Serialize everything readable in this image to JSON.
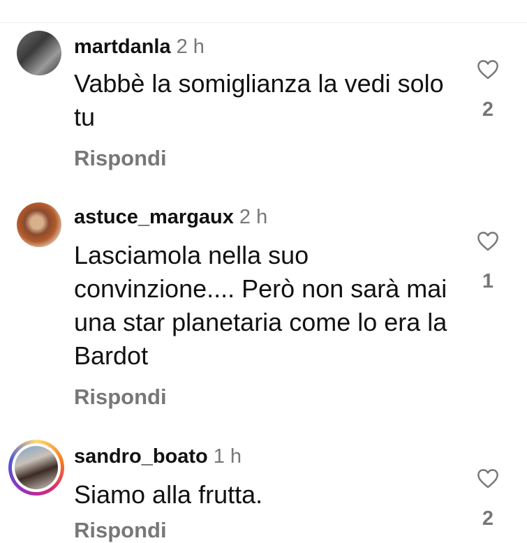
{
  "comments": [
    {
      "username": "martdanla",
      "time": "2 h",
      "text": "Vabbè la somiglianza la vedi solo tu",
      "reply_label": "Rispondi",
      "like_count": "2",
      "icons": {
        "avatar": "avatar-photo",
        "like": "heart-outline-icon"
      }
    },
    {
      "username": "astuce_margaux",
      "time": "2 h",
      "text": "Lasciamola nella suo convinzione.... Però non sarà mai una star planetaria come lo era la Bardot",
      "reply_label": "Rispondi",
      "like_count": "1",
      "icons": {
        "avatar": "avatar-photo",
        "like": "heart-outline-icon"
      }
    },
    {
      "username": "sandro_boato",
      "time": "1 h",
      "text": "Siamo alla frutta.",
      "reply_label": "Rispondi",
      "like_count": "2",
      "has_story_ring": true,
      "icons": {
        "avatar": "avatar-photo",
        "like": "heart-outline-icon"
      }
    }
  ],
  "colors": {
    "secondary_text": "#777777",
    "primary_text": "#111111",
    "story_ring": [
      "#feda75",
      "#fa7e1e",
      "#d62976",
      "#962fbf",
      "#4f5bd5"
    ]
  }
}
